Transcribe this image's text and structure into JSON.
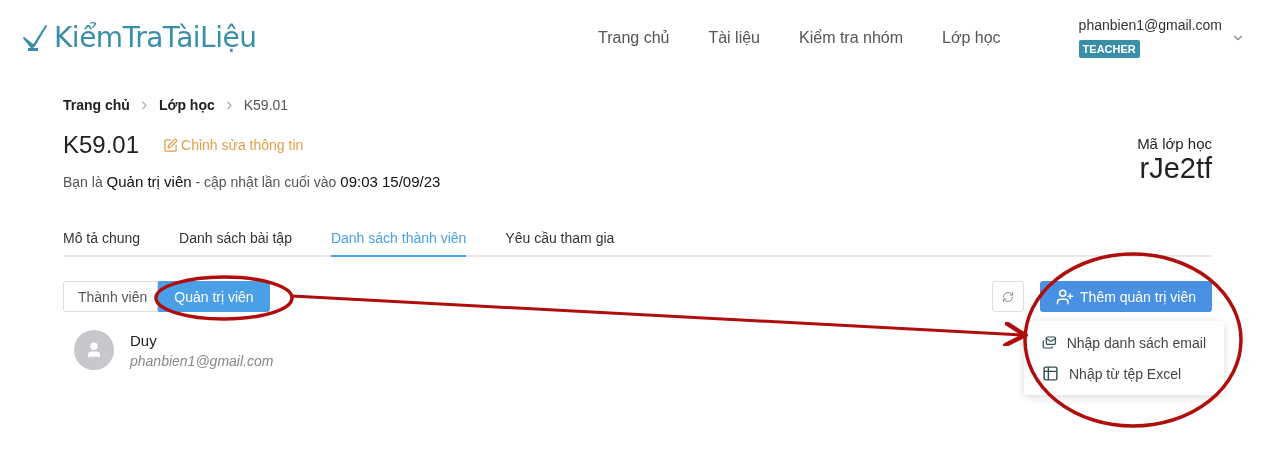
{
  "header": {
    "logo": "KiểmTraTàiLiệu",
    "nav": [
      {
        "label": "Trang chủ"
      },
      {
        "label": "Tài liệu"
      },
      {
        "label": "Kiểm tra nhóm"
      },
      {
        "label": "Lớp học"
      }
    ],
    "user": {
      "email": "phanbien1@gmail.com",
      "role": "TEACHER"
    }
  },
  "breadcrumb": [
    {
      "label": "Trang chủ",
      "current": false
    },
    {
      "label": "Lớp học",
      "current": false
    },
    {
      "label": "K59.01",
      "current": true
    }
  ],
  "class": {
    "name": "K59.01",
    "edit_link": "Chỉnh sửa thông tin",
    "info": "Bạn là **Quản trị viên** - cập nhật lần cuối vào **09:03 15/09/23**",
    "code_label": "Mã lớp học",
    "code": "rJe2tf"
  },
  "tabs": [
    {
      "label": "Mô tả chung",
      "selected": false
    },
    {
      "label": "Danh sách bài tập",
      "selected": false
    },
    {
      "label": "Danh sách thành viên",
      "selected": true
    },
    {
      "label": "Yêu cầu tham gia",
      "selected": false
    }
  ],
  "segments": [
    {
      "label": "Thành viên",
      "selected": false
    },
    {
      "label": "Quản trị viên",
      "selected": true
    }
  ],
  "add_button": {
    "label": "Thêm quản trị viên"
  },
  "dropdown": [
    {
      "kind": "email",
      "label": "Nhập danh sách email"
    },
    {
      "kind": "excel",
      "label": "Nhập từ tệp Excel"
    }
  ],
  "members": [
    {
      "name": "Duy",
      "email": "phanbien1@gmail.com"
    }
  ]
}
